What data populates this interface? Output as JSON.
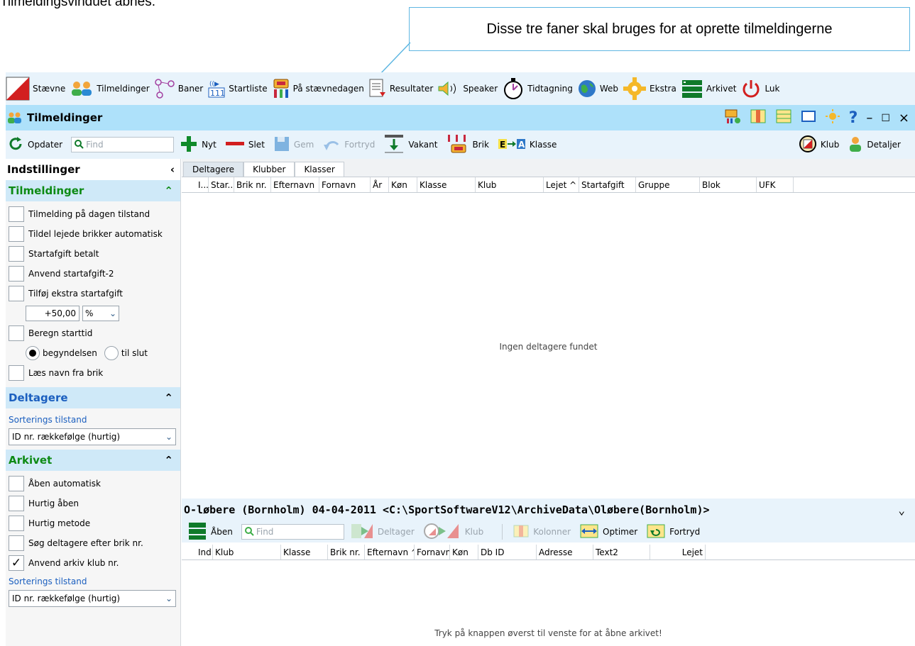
{
  "doc_text": "Tilmeldingsvinduet åbnes.",
  "callout": "Disse tre faner skal bruges for at oprette tilmeldingerne",
  "menu": [
    {
      "icon": "flag-icon",
      "label": "Stævne"
    },
    {
      "icon": "people-icon",
      "label": "Tilmeldinger"
    },
    {
      "icon": "course-icon",
      "label": "Baner"
    },
    {
      "icon": "startlist-icon",
      "label": "Startliste"
    },
    {
      "icon": "competition-day-icon",
      "label": "På stævnedagen"
    },
    {
      "icon": "results-icon",
      "label": "Resultater"
    },
    {
      "icon": "speaker-icon",
      "label": "Speaker"
    },
    {
      "icon": "stopwatch-icon",
      "label": "Tidtagning"
    },
    {
      "icon": "globe-icon",
      "label": "Web"
    },
    {
      "icon": "gear-icon",
      "label": "Ekstra"
    },
    {
      "icon": "archive-icon",
      "label": "Arkivet"
    },
    {
      "icon": "power-icon",
      "label": "Luk"
    }
  ],
  "window_title": "Tilmeldinger",
  "toolbar": {
    "update": "Opdater",
    "find_placeholder": "Find",
    "new": "Nyt",
    "delete": "Slet",
    "save": "Gem",
    "undo": "Fortryd",
    "vacant": "Vakant",
    "chip": "Brik",
    "class": "Klasse",
    "club": "Klub",
    "details": "Detaljer"
  },
  "sidebar": {
    "header": "Indstillinger",
    "sec1": "Tilmeldinger",
    "checks1": [
      "Tilmelding på dagen tilstand",
      "Tildel lejede brikker automatisk",
      "Startafgift betalt",
      "Anvend startafgift-2",
      "Tilføj ekstra startafgift"
    ],
    "fee_value": "+50,00",
    "fee_unit": "%",
    "calc_start": "Beregn starttid",
    "radio_begin": "begyndelsen",
    "radio_end": "til slut",
    "read_name": "Læs navn fra brik",
    "sec2": "Deltagere",
    "sort_label": "Sorterings tilstand",
    "sort_value": "ID nr. rækkefølge (hurtig)",
    "sec3": "Arkivet",
    "checks3": [
      "Åben automatisk",
      "Hurtig åben",
      "Hurtig metode",
      "Søg deltagere efter brik nr.",
      "Anvend arkiv klub nr."
    ],
    "sort_label2": "Sorterings tilstand",
    "sort_value2": "ID nr. rækkefølge (hurtig)"
  },
  "tabs": [
    "Deltagere",
    "Klubber",
    "Klasser"
  ],
  "columns": [
    "I...",
    "Star...",
    "Brik nr.",
    "Efternavn",
    "Fornavn",
    "År",
    "Køn",
    "Klasse",
    "Klub",
    "Lejet ^",
    "Startafgift",
    "Gruppe",
    "Blok",
    "UFK"
  ],
  "empty_text": "Ingen deltagere fundet",
  "archive_title": "O-løbere (Bornholm)  04-04-2011  <C:\\SportSoftwareV12\\ArchiveData\\Oløbere(Bornholm)>",
  "archive_toolbar": {
    "open": "Åben",
    "find_placeholder": "Find",
    "participant": "Deltager",
    "club": "Klub",
    "columns": "Kolonner",
    "optimize": "Optimer",
    "undo": "Fortryd"
  },
  "archive_columns": [
    "Ind",
    "Klub",
    "Klasse",
    "Brik nr.",
    "Efternavn ^",
    "Fornavn ^",
    "Køn",
    "Db ID",
    "Adresse",
    "Text2",
    "Lejet"
  ],
  "archive_empty": "Tryk på knappen øverst til venste for at åbne arkivet!"
}
